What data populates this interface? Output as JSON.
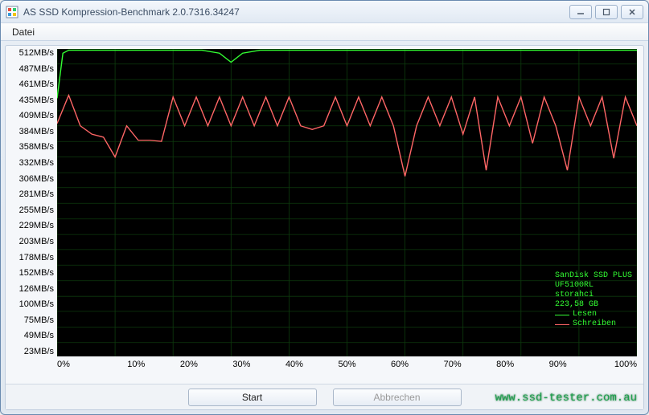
{
  "window": {
    "title": "AS SSD Kompression-Benchmark 2.0.7316.34247"
  },
  "menu": {
    "file": "Datei"
  },
  "buttons": {
    "start": "Start",
    "cancel": "Abbrechen"
  },
  "device": {
    "name": "SanDisk SSD PLUS",
    "model": "UF5100RL",
    "driver": "storahci",
    "size": "223,58 GB"
  },
  "legend": {
    "read": "Lesen",
    "write": "Schreiben",
    "read_color": "#33ff33",
    "write_color": "#ff6666"
  },
  "watermark": "www.ssd-tester.com.au",
  "chart_data": {
    "type": "line",
    "xlabel": "",
    "ylabel": "MB/s",
    "xlim": [
      0,
      100
    ],
    "ylim": [
      0,
      512
    ],
    "x_ticks": [
      "0%",
      "10%",
      "20%",
      "30%",
      "40%",
      "50%",
      "60%",
      "70%",
      "80%",
      "90%",
      "100%"
    ],
    "y_ticks": [
      "512MB/s",
      "487MB/s",
      "461MB/s",
      "435MB/s",
      "409MB/s",
      "384MB/s",
      "358MB/s",
      "332MB/s",
      "306MB/s",
      "281MB/s",
      "255MB/s",
      "229MB/s",
      "203MB/s",
      "178MB/s",
      "152MB/s",
      "126MB/s",
      "100MB/s",
      "75MB/s",
      "49MB/s",
      "23MB/s"
    ],
    "series": [
      {
        "name": "Lesen",
        "color": "#33ff33",
        "x": [
          0,
          1,
          2,
          5,
          10,
          15,
          20,
          25,
          28,
          30,
          32,
          35,
          40,
          45,
          50,
          55,
          60,
          65,
          70,
          75,
          80,
          85,
          90,
          95,
          100
        ],
        "values": [
          430,
          505,
          510,
          510,
          510,
          510,
          510,
          510,
          505,
          490,
          505,
          510,
          510,
          510,
          510,
          510,
          510,
          510,
          510,
          510,
          510,
          510,
          510,
          510,
          510
        ]
      },
      {
        "name": "Schreiben",
        "color": "#ff6666",
        "x": [
          0,
          2,
          4,
          6,
          8,
          10,
          12,
          14,
          16,
          18,
          20,
          22,
          24,
          26,
          28,
          30,
          32,
          34,
          36,
          38,
          40,
          42,
          44,
          46,
          48,
          50,
          52,
          54,
          56,
          58,
          60,
          62,
          64,
          66,
          68,
          70,
          72,
          74,
          76,
          78,
          80,
          82,
          84,
          86,
          88,
          90,
          92,
          94,
          96,
          98,
          100
        ],
        "values": [
          388,
          435,
          384,
          370,
          365,
          332,
          384,
          360,
          360,
          358,
          432,
          384,
          432,
          384,
          432,
          384,
          432,
          384,
          432,
          384,
          432,
          384,
          378,
          384,
          432,
          384,
          432,
          384,
          432,
          384,
          300,
          384,
          432,
          384,
          432,
          370,
          432,
          310,
          432,
          384,
          432,
          355,
          432,
          384,
          310,
          432,
          384,
          432,
          330,
          432,
          384
        ]
      }
    ]
  }
}
